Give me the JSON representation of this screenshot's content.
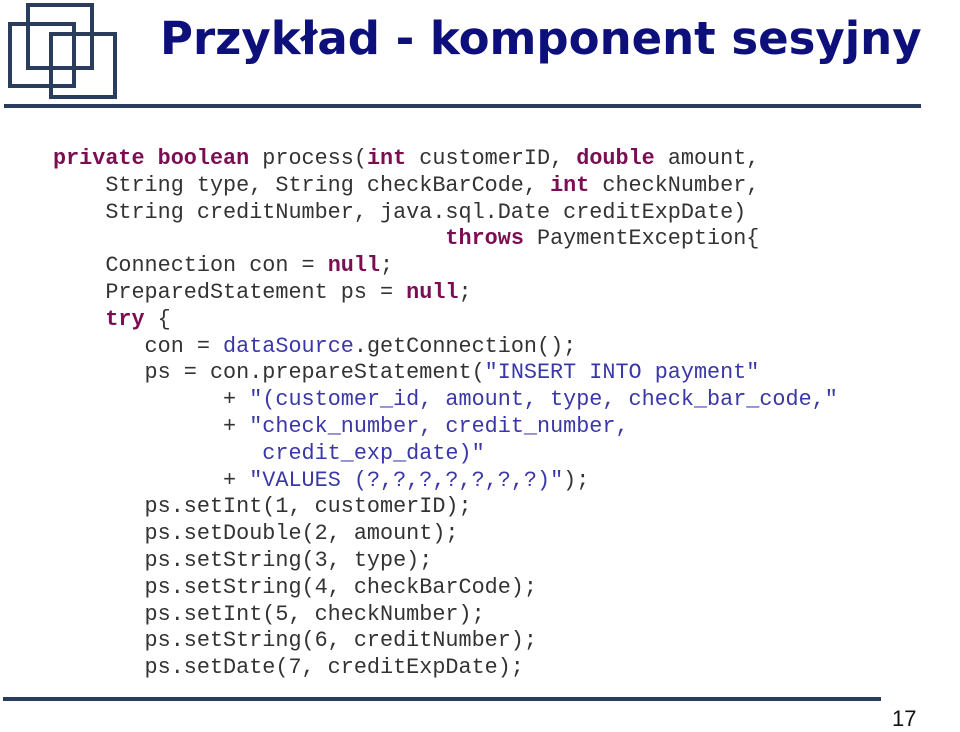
{
  "slide": {
    "title": "Przykład - komponent sesyjny",
    "page_number": "17",
    "logo_icon": "overlapping-squares-logo",
    "colors": {
      "title": "#0d0f7a",
      "keyword": "#7b0e52",
      "string": "#3a37a8",
      "code_text": "#333333",
      "rule": "#2b3d5c"
    }
  },
  "code": {
    "language": "java",
    "lines": [
      [
        {
          "t": "kw",
          "v": "private boolean"
        },
        {
          "t": "n",
          "v": " process("
        },
        {
          "t": "kw",
          "v": "int"
        },
        {
          "t": "n",
          "v": " customerID, "
        },
        {
          "t": "kw",
          "v": "double"
        },
        {
          "t": "n",
          "v": " amount,"
        }
      ],
      [
        {
          "t": "n",
          "v": "    String type, String checkBarCode, "
        },
        {
          "t": "kw",
          "v": "int"
        },
        {
          "t": "n",
          "v": " checkNumber,"
        }
      ],
      [
        {
          "t": "n",
          "v": "    String creditNumber, java.sql.Date creditExpDate)"
        }
      ],
      [
        {
          "t": "n",
          "v": "                              "
        },
        {
          "t": "kw",
          "v": "throws"
        },
        {
          "t": "n",
          "v": " PaymentException{"
        }
      ],
      [
        {
          "t": "n",
          "v": "    Connection con = "
        },
        {
          "t": "kw",
          "v": "null"
        },
        {
          "t": "n",
          "v": ";"
        }
      ],
      [
        {
          "t": "n",
          "v": "    PreparedStatement ps = "
        },
        {
          "t": "kw",
          "v": "null"
        },
        {
          "t": "n",
          "v": ";"
        }
      ],
      [
        {
          "t": "n",
          "v": "    "
        },
        {
          "t": "kw",
          "v": "try"
        },
        {
          "t": "n",
          "v": " {"
        }
      ],
      [
        {
          "t": "n",
          "v": "       con = "
        },
        {
          "t": "fld",
          "v": "dataSource"
        },
        {
          "t": "n",
          "v": ".getConnection();"
        }
      ],
      [
        {
          "t": "n",
          "v": "       ps = con.prepareStatement("
        },
        {
          "t": "str",
          "v": "\"INSERT INTO payment\""
        }
      ],
      [
        {
          "t": "n",
          "v": "             + "
        },
        {
          "t": "str",
          "v": "\"(customer_id, amount, type, check_bar_code,\""
        }
      ],
      [
        {
          "t": "n",
          "v": "             + "
        },
        {
          "t": "str",
          "v": "\"check_number, credit_number,"
        }
      ],
      [
        {
          "t": "str",
          "v": "                credit_exp_date)\""
        }
      ],
      [
        {
          "t": "n",
          "v": "             + "
        },
        {
          "t": "str",
          "v": "\"VALUES (?,?,?,?,?,?,?)\""
        },
        {
          "t": "n",
          "v": ");"
        }
      ],
      [
        {
          "t": "n",
          "v": "       ps.setInt(1, customerID);"
        }
      ],
      [
        {
          "t": "n",
          "v": "       ps.setDouble(2, amount);"
        }
      ],
      [
        {
          "t": "n",
          "v": "       ps.setString(3, type);"
        }
      ],
      [
        {
          "t": "n",
          "v": "       ps.setString(4, checkBarCode);"
        }
      ],
      [
        {
          "t": "n",
          "v": "       ps.setInt(5, checkNumber);"
        }
      ],
      [
        {
          "t": "n",
          "v": "       ps.setString(6, creditNumber);"
        }
      ],
      [
        {
          "t": "n",
          "v": "       ps.setDate(7, creditExpDate);"
        }
      ]
    ]
  }
}
